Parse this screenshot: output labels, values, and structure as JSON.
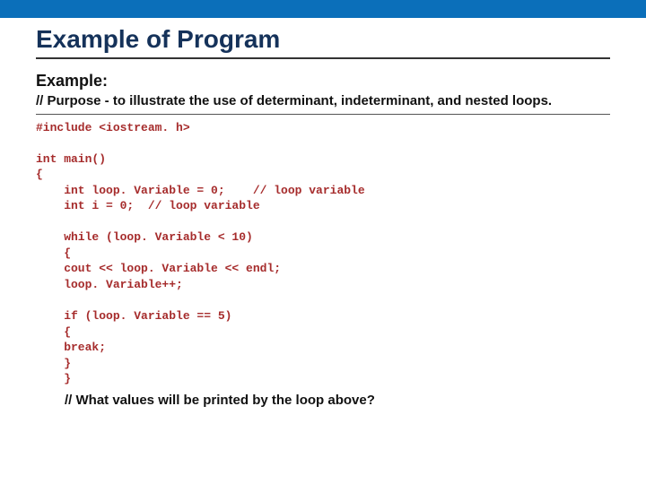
{
  "slide": {
    "title": "Example of Program",
    "exampleLabel": "Example:",
    "purpose": "// Purpose - to illustrate the use of determinant, indeterminant, and nested loops.",
    "code": "#include <iostream. h>\n\nint main()\n{\n    int loop. Variable = 0;    // loop variable\n    int i = 0;  // loop variable\n\n    while (loop. Variable < 10)\n    {\n    cout << loop. Variable << endl;\n    loop. Variable++;\n\n    if (loop. Variable == 5)\n    {\n    break;\n    }\n    }",
    "question": "// What values will be printed by the loop above?"
  }
}
